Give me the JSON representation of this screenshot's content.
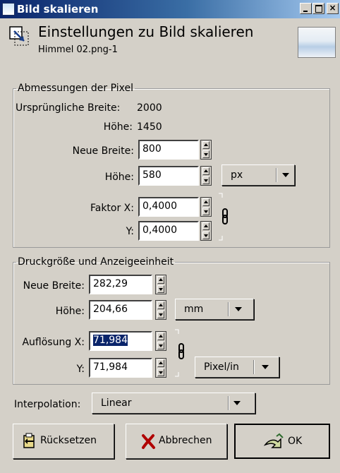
{
  "window": {
    "title": "Bild skalieren",
    "minimize_glyph": "_",
    "maximize_glyph": "□",
    "close_glyph": "×"
  },
  "header": {
    "title": "Einstellungen zu Bild skalieren",
    "subtitle": "Himmel 02.png-1"
  },
  "pixel_dimensions": {
    "legend": "Abmessungen der Pixel",
    "orig_width_label": "Ursprüngliche Breite:",
    "orig_width_value": "2000",
    "orig_height_label": "Höhe:",
    "orig_height_value": "1450",
    "new_width_label": "Neue Breite:",
    "new_width_value": "800",
    "height_label": "Höhe:",
    "height_value": "580",
    "unit": "px",
    "factor_x_label": "Faktor X:",
    "factor_x_value": "0,4000",
    "factor_y_label": "Y:",
    "factor_y_value": "0,4000"
  },
  "print_size": {
    "legend": "Druckgröße und Anzeigeeinheit",
    "new_width_label": "Neue Breite:",
    "new_width_value": "282,29",
    "height_label": "Höhe:",
    "height_value": "204,66",
    "unit": "mm",
    "resolution_x_label": "Auflösung X:",
    "resolution_x_value": "71,984",
    "resolution_y_label": "Y:",
    "resolution_y_value": "71,984",
    "resolution_unit": "Pixel/in"
  },
  "interpolation": {
    "label": "Interpolation:",
    "value": "Linear"
  },
  "buttons": {
    "reset": "Rücksetzen",
    "cancel": "Abbrechen",
    "ok": "OK"
  },
  "icons": {
    "title_icon": "gimp-window-icon",
    "header_icon": "scale-image-icon",
    "chain": "chain-link-icon",
    "reset": "reset-icon",
    "cancel": "cancel-x-icon",
    "ok": "ok-check-icon"
  }
}
